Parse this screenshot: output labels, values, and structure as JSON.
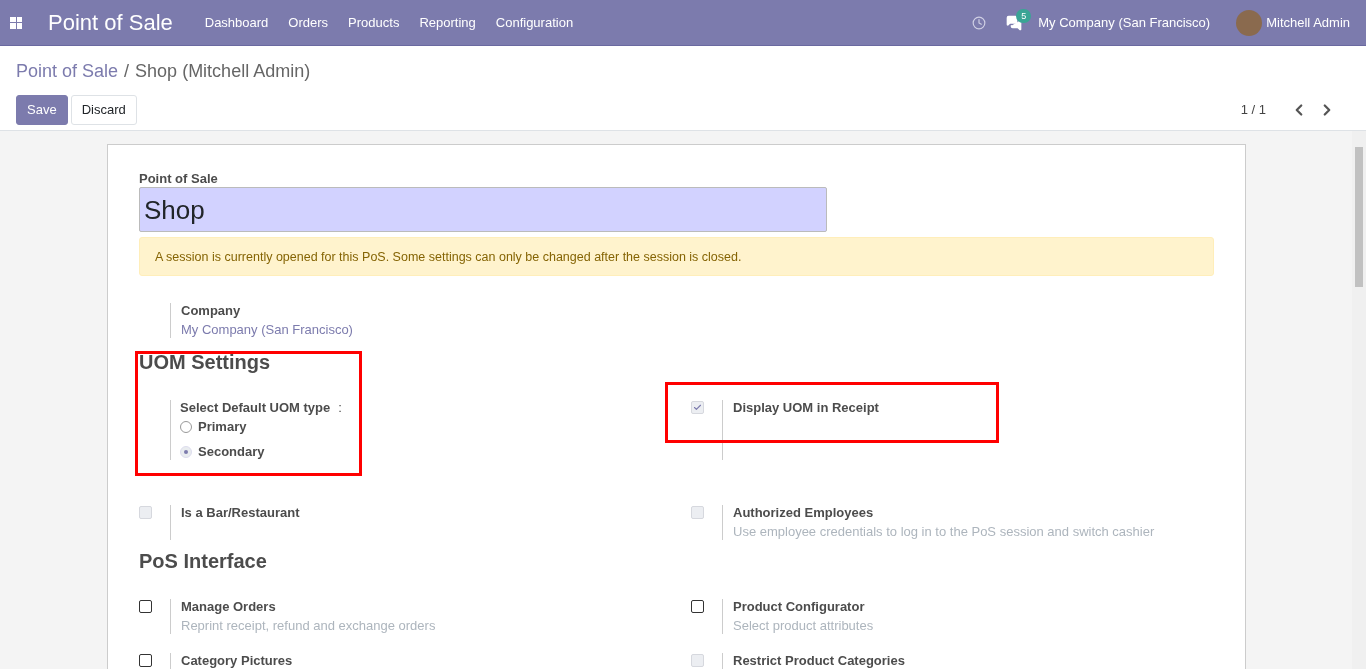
{
  "navbar": {
    "app_title": "Point of Sale",
    "menu": [
      "Dashboard",
      "Orders",
      "Products",
      "Reporting",
      "Configuration"
    ],
    "message_count": "5",
    "company": "My Company (San Francisco)",
    "user": "Mitchell Admin"
  },
  "breadcrumb": {
    "parent": "Point of Sale",
    "separator": "/",
    "current": "Shop (Mitchell Admin)"
  },
  "buttons": [
    {
      "label": "Save",
      "kind": "primary"
    },
    {
      "label": "Discard",
      "kind": "secondary"
    }
  ],
  "pager": "1 / 1",
  "form": {
    "name_label": "Point of Sale",
    "name_value": "Shop",
    "alert": "A session is currently opened for this PoS. Some settings can only be changed after the session is closed.",
    "company": {
      "label": "Company",
      "value": "My Company (San Francisco)"
    },
    "sections": [
      {
        "title": "UOM Settings",
        "settings": [
          {
            "kind": "radio",
            "label": "Select Default UOM type",
            "separator": ":",
            "highlighted": true,
            "options": [
              {
                "label": "Primary",
                "selected": false
              },
              {
                "label": "Secondary",
                "selected": true
              }
            ]
          },
          {
            "kind": "checkbox",
            "label": "Display UOM in Receipt",
            "checked": true,
            "disabled": true,
            "highlighted": true
          }
        ]
      },
      {
        "settings": [
          {
            "kind": "checkbox",
            "label": "Is a Bar/Restaurant",
            "checked": false,
            "disabled": true,
            "highlighted": false
          },
          {
            "kind": "checkbox",
            "label": "Authorized Employees",
            "description": "Use employee credentials to log in to the PoS session and switch cashier",
            "checked": false,
            "disabled": true,
            "highlighted": false
          }
        ]
      },
      {
        "title": "PoS Interface",
        "settings": [
          {
            "kind": "checkbox",
            "label": "Manage Orders",
            "description": "Reprint receipt, refund and exchange orders",
            "checked": false,
            "disabled": false,
            "highlighted": false
          },
          {
            "kind": "checkbox",
            "label": "Product Configurator",
            "description": "Select product attributes",
            "checked": false,
            "disabled": false,
            "highlighted": false
          },
          {
            "kind": "checkbox",
            "label": "Category Pictures",
            "checked": false,
            "disabled": false,
            "highlighted": false
          },
          {
            "kind": "checkbox",
            "label": "Restrict Product Categories",
            "checked": false,
            "disabled": true,
            "highlighted": false
          }
        ]
      }
    ]
  }
}
